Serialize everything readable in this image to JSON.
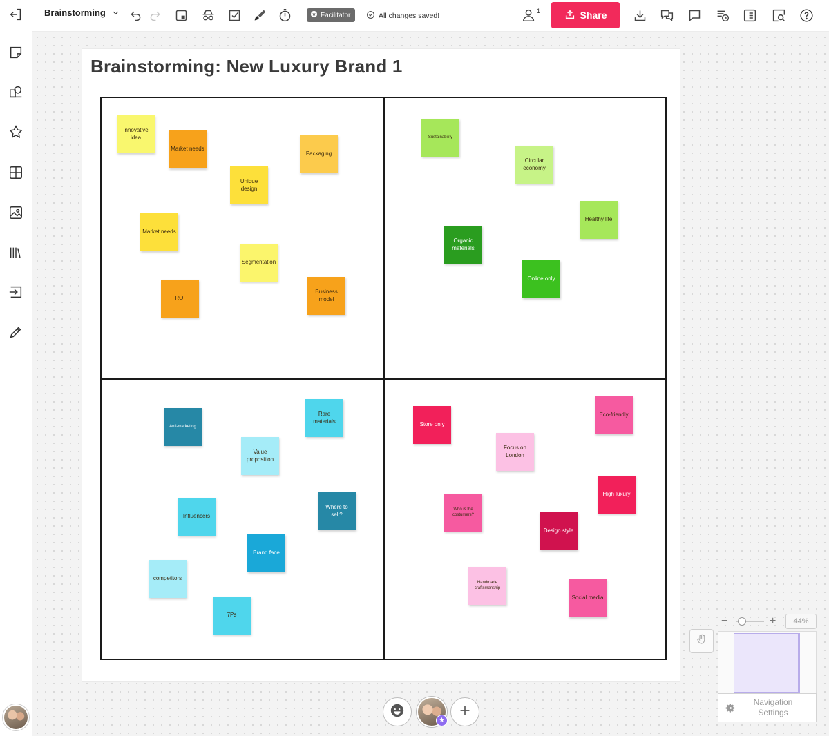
{
  "topbar": {
    "board_name": "Brainstorming",
    "facilitator_label": "Facilitator",
    "saved_status": "All changes saved!",
    "share_label": "Share",
    "user_count": "1"
  },
  "board": {
    "title": "Brainstorming: New Luxury Brand 1",
    "notes": [
      {
        "text": "Innovative idea",
        "color": "#f9f76e"
      },
      {
        "text": "Market needs",
        "color": "#f7a21b"
      },
      {
        "text": "Packaging",
        "color": "#fccb4c"
      },
      {
        "text": "Unique design",
        "color": "#fde03a"
      },
      {
        "text": "Market needs",
        "color": "#fde03a"
      },
      {
        "text": "Segmentation",
        "color": "#fbf56c"
      },
      {
        "text": "ROI",
        "color": "#f7a21b"
      },
      {
        "text": "Business model",
        "color": "#f7a21b"
      },
      {
        "text": "Sustainability",
        "color": "#a6e75a"
      },
      {
        "text": "Circular economy",
        "color": "#c7f387"
      },
      {
        "text": "Healthy life",
        "color": "#a6e75a"
      },
      {
        "text": "Organic materials",
        "color": "#2a9d1f"
      },
      {
        "text": "Online only",
        "color": "#3cc11f"
      },
      {
        "text": "Anti-marketing",
        "color": "#2688a6"
      },
      {
        "text": "Rare materials",
        "color": "#4fd6ec"
      },
      {
        "text": "Value proposition",
        "color": "#a5ecf8"
      },
      {
        "text": "Influencers",
        "color": "#4fd6ec"
      },
      {
        "text": "Where to sell?",
        "color": "#2688a6"
      },
      {
        "text": "Brand face",
        "color": "#1aa8d8"
      },
      {
        "text": "competitors",
        "color": "#a5ecf8"
      },
      {
        "text": "7Ps",
        "color": "#4fd6ec"
      },
      {
        "text": "Store only",
        "color": "#f2205a"
      },
      {
        "text": "Eco-friendly",
        "color": "#f65aa0"
      },
      {
        "text": "Focus on London",
        "color": "#fcc1e4"
      },
      {
        "text": "High luxury",
        "color": "#f2205a"
      },
      {
        "text": "Who is the costumers?",
        "color": "#f65aa0"
      },
      {
        "text": "Design style",
        "color": "#d0124e"
      },
      {
        "text": "Handmade craftsmanship",
        "color": "#fcc1e4"
      },
      {
        "text": "Social media",
        "color": "#f65aa0"
      }
    ]
  },
  "zoom": {
    "minus": "−",
    "plus": "+",
    "level": "44%"
  },
  "nav_settings_label": "Navigation Settings",
  "icons": {
    "left": [
      "exit-board-icon",
      "sticky-note-icon",
      "shapes-icon",
      "star-icon",
      "grid-icon",
      "image-icon",
      "library-icon",
      "import-icon",
      "pencil-icon"
    ],
    "top": [
      "undo-icon",
      "redo-icon",
      "frame-icon",
      "spy-icon",
      "checkbox-icon",
      "brush-icon",
      "timer-icon",
      "download-icon",
      "chat-icon",
      "comment-icon",
      "activity-icon",
      "list-icon",
      "search-icon",
      "help-icon"
    ]
  }
}
